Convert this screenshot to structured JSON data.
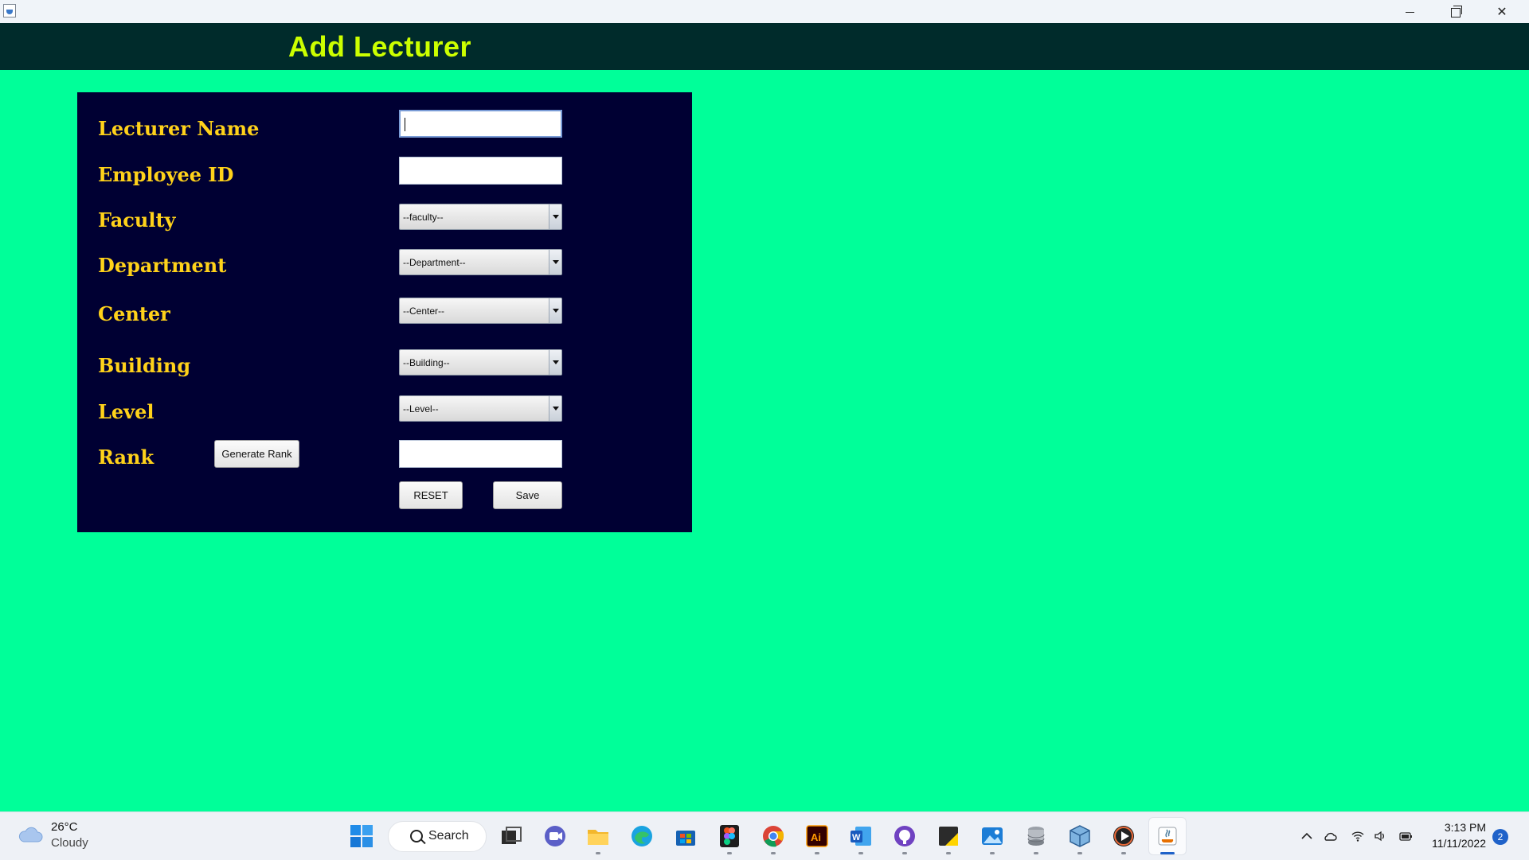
{
  "window": {
    "title": "",
    "controls": {
      "minimize": "minimize-icon",
      "maximize": "restore-icon",
      "close": "close-icon"
    }
  },
  "header": {
    "title": "Add Lecturer"
  },
  "form": {
    "fields": [
      {
        "label": "Lecturer Name",
        "type": "text",
        "value": ""
      },
      {
        "label": "Employee ID",
        "type": "text",
        "value": ""
      },
      {
        "label": "Faculty",
        "type": "select",
        "value": "--faculty--"
      },
      {
        "label": "Department",
        "type": "select",
        "value": "--Department--"
      },
      {
        "label": "Center",
        "type": "select",
        "value": "--Center--"
      },
      {
        "label": "Building",
        "type": "select",
        "value": "--Building--"
      },
      {
        "label": "Level",
        "type": "select",
        "value": "--Level--"
      },
      {
        "label": "Rank",
        "type": "text",
        "value": ""
      }
    ],
    "generate_rank_label": "Generate Rank",
    "reset_label": "RESET",
    "save_label": "Save"
  },
  "taskbar": {
    "weather": {
      "temp": "26°C",
      "desc": "Cloudy"
    },
    "search_label": "Search",
    "apps": [
      "task-view",
      "teams-chat",
      "file-explorer",
      "edge",
      "store",
      "figma",
      "chrome",
      "illustrator",
      "word",
      "github-desktop",
      "sticky-notes",
      "photos",
      "database",
      "virtualbox",
      "media-player",
      "java"
    ],
    "clock": {
      "time": "3:13 PM",
      "date": "11/11/2022"
    },
    "notifications": "2"
  },
  "colors": {
    "background": "#00ff99",
    "header": "#002b2b",
    "header_title": "#ccff00",
    "panel": "#000033",
    "label": "#ffd21a"
  }
}
